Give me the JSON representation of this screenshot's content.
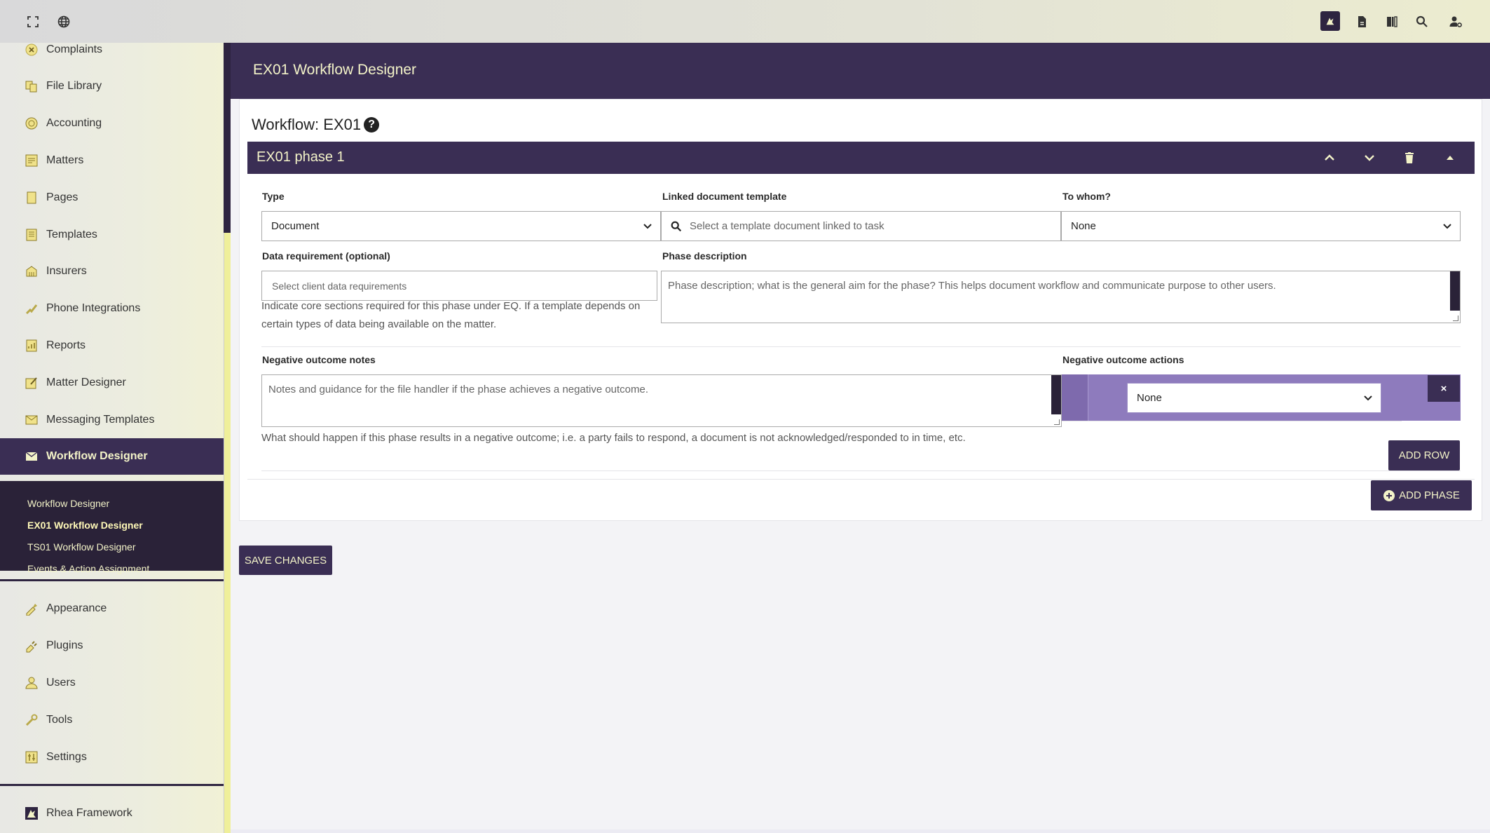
{
  "topbar": {
    "left_icons": [
      "expand-icon",
      "globe-icon"
    ],
    "right_icons": [
      "rhea-logo-icon",
      "file-icon",
      "panel-icon",
      "search-icon",
      "user-settings-icon"
    ]
  },
  "sidebar": {
    "items": [
      {
        "label": "Complaints",
        "icon": "complaints-icon"
      },
      {
        "label": "File Library",
        "icon": "file-library-icon"
      },
      {
        "label": "Accounting",
        "icon": "accounting-icon"
      },
      {
        "label": "Matters",
        "icon": "matters-icon"
      },
      {
        "label": "Pages",
        "icon": "pages-icon"
      },
      {
        "label": "Templates",
        "icon": "templates-icon"
      },
      {
        "label": "Insurers",
        "icon": "insurers-icon"
      },
      {
        "label": "Phone Integrations",
        "icon": "phone-icon"
      },
      {
        "label": "Reports",
        "icon": "reports-icon"
      },
      {
        "label": "Matter Designer",
        "icon": "matter-designer-icon"
      },
      {
        "label": "Messaging Templates",
        "icon": "envelope-icon"
      },
      {
        "label": "Workflow Designer",
        "icon": "envelope-icon"
      }
    ],
    "sub_items": [
      {
        "label": "Workflow Designer"
      },
      {
        "label": "EX01 Workflow Designer"
      },
      {
        "label": "TS01 Workflow Designer"
      },
      {
        "label": "Events & Action Assignment"
      }
    ],
    "bottom_items": [
      {
        "label": "Appearance",
        "icon": "appearance-icon"
      },
      {
        "label": "Plugins",
        "icon": "plugin-icon"
      },
      {
        "label": "Users",
        "icon": "user-icon"
      },
      {
        "label": "Tools",
        "icon": "wrench-icon"
      },
      {
        "label": "Settings",
        "icon": "settings-icon"
      }
    ],
    "footer_item": {
      "label": "Rhea Framework",
      "icon": "rhea-logo-icon"
    }
  },
  "page": {
    "header_title": "EX01 Workflow Designer",
    "workflow_title": "Workflow: EX01",
    "help_glyph": "?"
  },
  "phase": {
    "title": "EX01 phase 1",
    "type_label": "Type",
    "type_value": "Document",
    "linked_label": "Linked document template",
    "linked_placeholder": "Select a template document linked to task",
    "to_whom_label": "To whom?",
    "to_whom_value": "None",
    "data_req_label": "Data requirement (optional)",
    "data_req_placeholder": "Select client data requirements",
    "data_req_help": "Indicate core sections required for this phase under EQ. If a template depends on certain types of data being available on the matter.",
    "phase_desc_label": "Phase description",
    "phase_desc_placeholder": "Phase description; what is the general aim for the phase? This helps document workflow and communicate purpose to other users.",
    "neg_notes_label": "Negative outcome notes",
    "neg_notes_placeholder": "Notes and guidance for the file handler if the phase achieves a negative outcome.",
    "neg_notes_help": "What should happen if this phase results in a negative outcome; i.e. a party fails to respond, a document is not acknowledged/responded to in time, etc.",
    "neg_actions_label": "Negative outcome actions",
    "neg_actions_value": "None",
    "remove_glyph": "×",
    "add_row_label": "ADD ROW"
  },
  "actions": {
    "add_phase_label": "ADD PHASE",
    "save_label": "SAVE CHANGES"
  },
  "colors": {
    "primary": "#3a2e54",
    "accent_text": "#f3f3c8",
    "neg_action_bg": "#8e7bbd"
  }
}
